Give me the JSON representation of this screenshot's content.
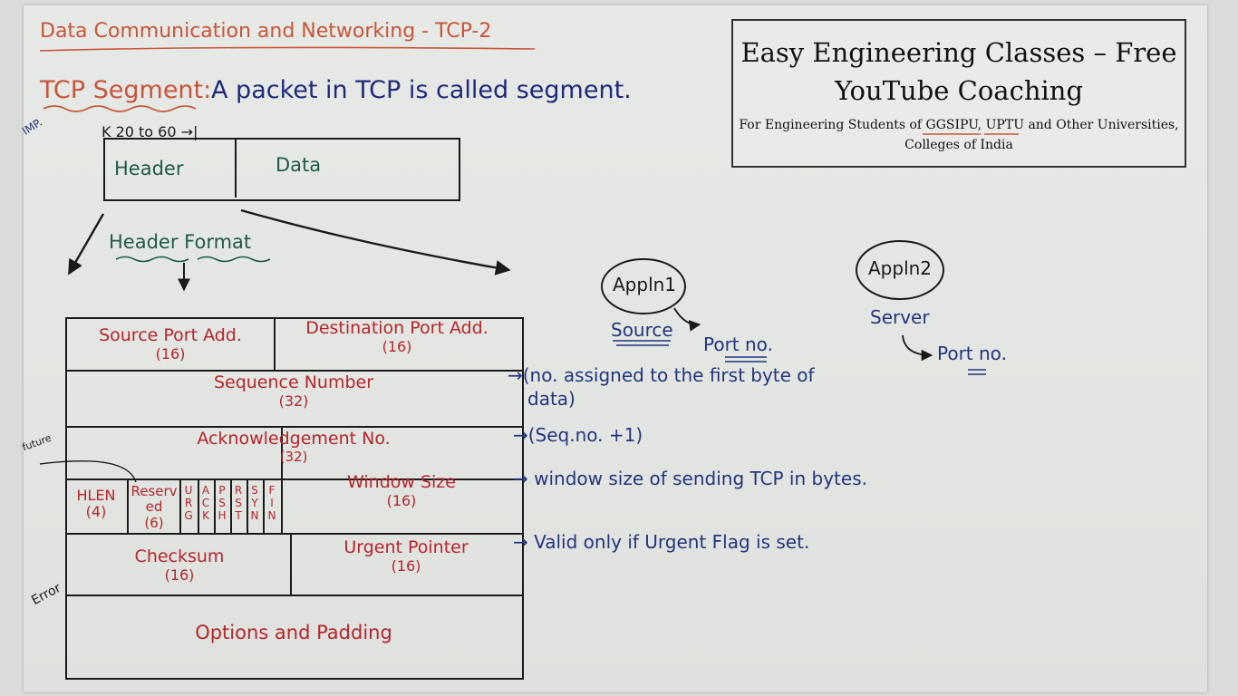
{
  "page": {
    "title": "Data Communication and Networking - TCP-2",
    "segment_label": "TCP Segment:",
    "segment_definition": "A packet in TCP is called segment.",
    "imp_note": "IMP.",
    "size_range": "K 20 to 60 →|",
    "segment_header": "Header",
    "segment_data": "Data",
    "header_format": "Header Format"
  },
  "header_table": {
    "source_port": {
      "label": "Source Port Add.",
      "bits": "(16)"
    },
    "destination_port": {
      "label": "Destination Port Add.",
      "bits": "(16)"
    },
    "sequence_number": {
      "label": "Sequence Number",
      "bits": "(32)"
    },
    "acknowledgement": {
      "label": "Acknowledgement No.",
      "bits": "(32)"
    },
    "hlen": {
      "label": "HLEN",
      "bits": "(4)"
    },
    "reserved": {
      "label": "Reserved",
      "bits": "(6)"
    },
    "flags": [
      {
        "letters": [
          "U",
          "R",
          "G"
        ]
      },
      {
        "letters": [
          "A",
          "C",
          "K"
        ]
      },
      {
        "letters": [
          "P",
          "S",
          "H"
        ]
      },
      {
        "letters": [
          "R",
          "S",
          "T"
        ]
      },
      {
        "letters": [
          "S",
          "Y",
          "N"
        ]
      },
      {
        "letters": [
          "F",
          "I",
          "N"
        ]
      }
    ],
    "window_size": {
      "label": "Window Size",
      "bits": "(16)"
    },
    "checksum": {
      "label": "Checksum",
      "bits": "(16)"
    },
    "urgent_pointer": {
      "label": "Urgent Pointer",
      "bits": "(16)"
    },
    "options": {
      "label": "Options and Padding"
    }
  },
  "margin_notes": {
    "future": "future",
    "error": "Error"
  },
  "side_notes": {
    "sequence": "→(no. assigned to the first byte of data)",
    "sequence_line1": "→(no. assigned to the first byte of",
    "sequence_line2": "data)",
    "ack": "→(Seq.no. +1)",
    "window": "→ window size of sending TCP in bytes.",
    "urgent": "→ Valid only if Urgent Flag is set."
  },
  "application_diagram": {
    "appln1": "Appln1",
    "source": "Source",
    "port1": "Port no.",
    "appln2": "Appln2",
    "server": "Server",
    "port2": "Port no."
  },
  "brand": {
    "line1": "Easy Engineering Classes – Free",
    "line2": "YouTube Coaching",
    "line3": "For Engineering Students of GGSIPU, UPTU and Other Universities,",
    "line4": "Colleges of India"
  },
  "colors": {
    "title": "#c8553a",
    "definition": "#1f2a7a",
    "diagram_text": "#1f5a48",
    "table_text": "#b5262b",
    "notes": "#22357f"
  }
}
